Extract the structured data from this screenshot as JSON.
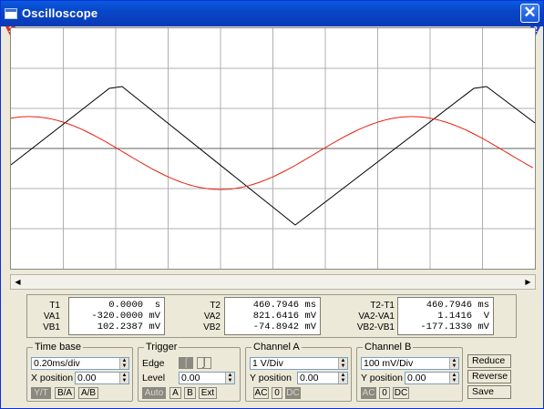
{
  "window": {
    "title": "Oscilloscope",
    "close_glyph": "✕"
  },
  "markers": {
    "t1": "1",
    "t2": "2"
  },
  "traces": {
    "channel_a_color": "#000000",
    "channel_b_color": "#e82010",
    "grid_color": "#b0b0b0",
    "axis_color": "#606060"
  },
  "readout": {
    "col1": {
      "labels": [
        "T1",
        "VA1",
        "VB1"
      ],
      "values": [
        "0.0000  s",
        "-320.0000 mV",
        "102.2387 mV"
      ]
    },
    "col2": {
      "labels": [
        "T2",
        "VA2",
        "VB2"
      ],
      "values": [
        "460.7946 ms",
        "821.6416 mV",
        "-74.8942 mV"
      ]
    },
    "col3": {
      "labels": [
        "T2-T1",
        "VA2-VA1",
        "VB2-VB1"
      ],
      "values": [
        "460.7946 ms",
        "1.1416  V",
        "-177.1330 mV"
      ]
    }
  },
  "timebase": {
    "title": "Time base",
    "scale": "0.20ms/div",
    "xpos_label": "X position",
    "xpos": "0.00",
    "modes": [
      "Y/T",
      "B/A",
      "A/B"
    ]
  },
  "trigger": {
    "title": "Trigger",
    "edge_label": "Edge",
    "level_label": "Level",
    "level": "0.00",
    "rise_glyph": "⌠",
    "fall_glyph": "⌡",
    "sources": [
      "Auto",
      "A",
      "B",
      "Ext"
    ]
  },
  "channel_a": {
    "title": "Channel A",
    "scale": "1  V/Div",
    "ypos_label": "Y position",
    "ypos": "0.00",
    "coupling": [
      "AC",
      "0",
      "DC"
    ]
  },
  "channel_b": {
    "title": "Channel B",
    "scale": "100 mV/Div",
    "ypos_label": "Y position",
    "ypos": "0.00",
    "coupling": [
      "AC",
      "0",
      "DC"
    ]
  },
  "actions": {
    "reduce": "Reduce",
    "reverse": "Reverse",
    "save": "Save"
  }
}
